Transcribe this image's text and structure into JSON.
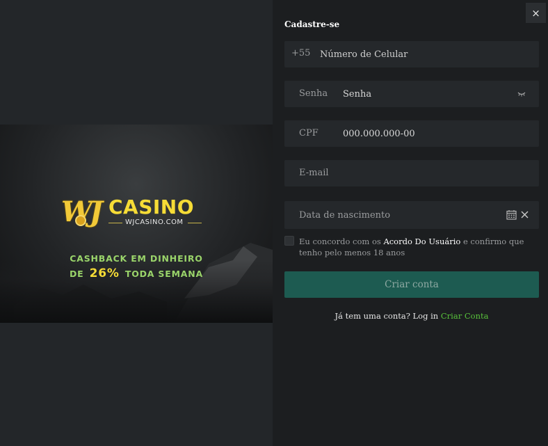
{
  "banner": {
    "logo_wj": "WJ",
    "logo_casino": "CASINO",
    "logo_site": "WJCASINO.COM",
    "promo_line1": "CASHBACK EM DINHEIRO",
    "promo_line2_prefix": "DE",
    "promo_percent": "26%",
    "promo_line2_suffix": "TODA SEMANA"
  },
  "form": {
    "title": "Cadastre-se",
    "close_icon": "×",
    "phone": {
      "prefix": "+55",
      "placeholder": "Número de Celular"
    },
    "password": {
      "label": "Senha",
      "placeholder": "Senha",
      "icon": "eye-closed-icon"
    },
    "cpf": {
      "label": "CPF",
      "placeholder": "000.000.000-00"
    },
    "email": {
      "placeholder": "E-mail"
    },
    "birthdate": {
      "placeholder": "Data de nascimento",
      "icons": [
        "calendar-icon",
        "clear-icon"
      ]
    },
    "agreement": {
      "text_before": "Eu concordo com os ",
      "link": "Acordo Do Usuário",
      "text_after": " e confirmo que tenho pelo menos 18 anos"
    },
    "submit_label": "Criar conta",
    "login_prompt": "Já tem uma conta? Log in ",
    "login_link": "Criar Conta"
  },
  "colors": {
    "accent_green": "#58c23b",
    "button_bg": "#1d5b51",
    "panel_bg": "#1c1e20",
    "field_bg": "#25282b"
  }
}
